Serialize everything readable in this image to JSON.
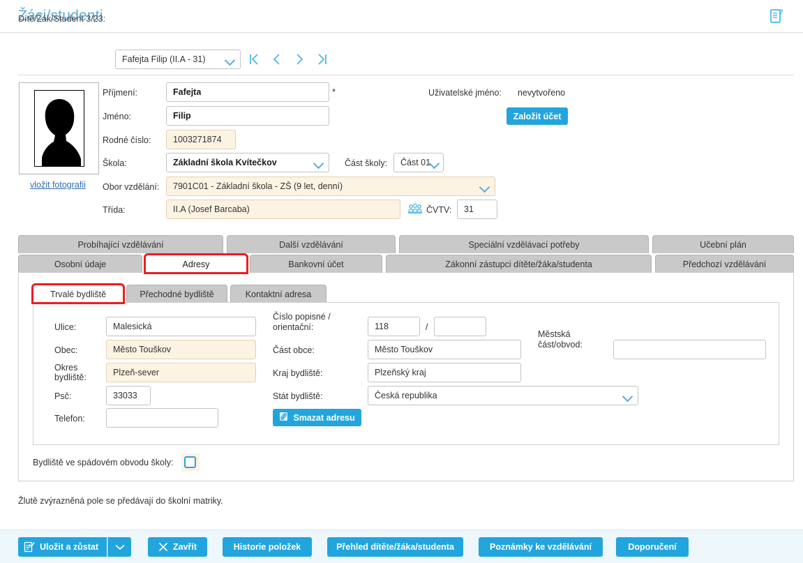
{
  "header": {
    "title": "Žáci/studenti",
    "help_icon": "document-question-icon"
  },
  "selector": {
    "label": "Dítě/Žák/Student 3/23:",
    "value": "Fafejta Filip (II.A - 31)",
    "nav": {
      "first": "first-record",
      "prev": "previous-record",
      "next": "next-record",
      "last": "last-record"
    }
  },
  "photo": {
    "link": "vložit fotografii",
    "placeholder": "person-silhouette"
  },
  "form": {
    "surname_label": "Příjmení:",
    "surname_value": "Fafejta",
    "required_mark": "*",
    "firstname_label": "Jméno:",
    "firstname_value": "Filip",
    "birthnum_label": "Rodné číslo:",
    "birthnum_value": "1003271874",
    "school_label": "Škola:",
    "school_value": "Základní škola Kvítečkov",
    "schoolpart_label": "Část školy:",
    "schoolpart_value": "Část 01",
    "field_label": "Obor vzdělání:",
    "field_value": "7901C01 - Základní škola - ZŠ (9 let, denní)",
    "class_label": "Třída:",
    "class_value": "II.A (Josef Barcaba)",
    "cvtv_label": "ČVTV:",
    "cvtv_value": "31",
    "cvtv_icon": "people-group-icon",
    "username_label": "Uživatelské jméno:",
    "username_value": "nevytvořeno",
    "create_account_button": "Založit účet"
  },
  "tabs_row1": [
    {
      "label": "Probíhající vzdělávání",
      "active": false
    },
    {
      "label": "Další vzdělávání",
      "active": false
    },
    {
      "label": "Speciální vzdělávací potřeby",
      "active": false
    },
    {
      "label": "Učební plán",
      "active": false
    }
  ],
  "tabs_row2": [
    {
      "label": "Osobní údaje",
      "active": false,
      "highlight": false
    },
    {
      "label": "Adresy",
      "active": true,
      "highlight": true
    },
    {
      "label": "Bankovní účet",
      "active": false,
      "highlight": false
    },
    {
      "label": "Zákonní zástupci dítěte/žáka/studenta",
      "active": false,
      "highlight": false
    },
    {
      "label": "Předchozí vzdělávání",
      "active": false,
      "highlight": false
    }
  ],
  "subtabs": [
    {
      "label": "Trvalé bydliště",
      "active": true,
      "highlight": true
    },
    {
      "label": "Přechodné bydliště",
      "active": false,
      "highlight": false
    },
    {
      "label": "Kontaktní adresa",
      "active": false,
      "highlight": false
    }
  ],
  "address": {
    "street_label": "Ulice:",
    "street_value": "Malesická",
    "city_label": "Obec:",
    "city_value": "Město Touškov",
    "district_label": "Okres bydliště:",
    "district_value": "Plzeň-sever",
    "zip_label": "Psč:",
    "zip_value": "33033",
    "phone_label": "Telefon:",
    "phone_value": "",
    "housenum_label": "Číslo popisné / orientační:",
    "housenum_value": "118",
    "housenum_separator": "/",
    "orientnum_value": "",
    "citypart_label": "Část obce:",
    "citypart_value": "Město Touškov",
    "region_label": "Kraj bydliště:",
    "region_value": "Plzeňský kraj",
    "country_label": "Stát bydliště:",
    "country_value": "Česká republika",
    "urbandistrict_label": "Městská část/obvod:",
    "urbandistrict_value": "",
    "delete_button": "Smazat adresu",
    "delete_icon": "trash-icon"
  },
  "catchment": {
    "label": "Bydliště ve spádovém obvodu školy:",
    "checked": false
  },
  "note": "Žlutě zvýrazněná pole se předávají do školní matriky.",
  "footer": {
    "save_label": "Uložit a zůstat",
    "save_icon": "document-check-icon",
    "save_dropdown_icon": "chevron-down-icon",
    "close_label": "Zavřít",
    "close_icon": "x-icon",
    "history_label": "Historie položek",
    "overview_label": "Přehled dítěte/žáka/studenta",
    "notes_label": "Poznámky ke vzdělávání",
    "recommend_label": "Doporučení"
  },
  "colors": {
    "accent": "#22a5dd",
    "title": "#5bacd6",
    "highlight_field": "#fdf3e3",
    "red_outline": "#ee1c22",
    "tab_inactive": "#c9c9c9",
    "footer_bg": "#eef7fb"
  }
}
